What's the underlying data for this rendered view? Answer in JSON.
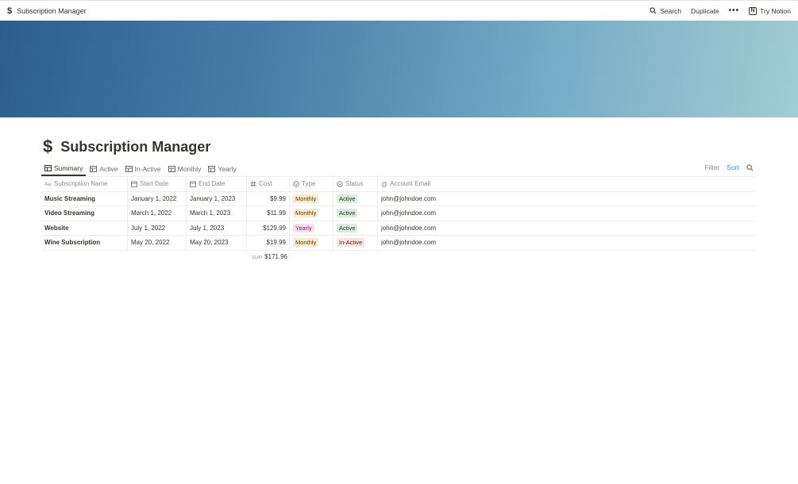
{
  "topbar": {
    "breadcrumb_icon": "$",
    "breadcrumb_title": "Subscription Manager",
    "search_label": "Search",
    "duplicate_label": "Duplicate",
    "more_label": "•••",
    "try_notion_label": "Try Notion"
  },
  "page": {
    "icon": "$",
    "title": "Subscription Manager"
  },
  "tabs": [
    {
      "label": "Summary",
      "active": true
    },
    {
      "label": "Active"
    },
    {
      "label": "In-Active"
    },
    {
      "label": "Monthly"
    },
    {
      "label": "Yearly"
    }
  ],
  "tools": {
    "filter_label": "Filter",
    "sort_label": "Sort"
  },
  "table": {
    "columns": [
      "Subscription Name",
      "Start Date",
      "End Date",
      "Cost",
      "Type",
      "Status",
      "Account Email"
    ],
    "rows": [
      {
        "name": "Music Streaming",
        "start": "January 1, 2022",
        "end": "January 1, 2023",
        "cost": "$9.99",
        "type": "Monthly",
        "status": "Active",
        "email": "john@johndoe.com"
      },
      {
        "name": "Video Streaming",
        "start": "March 1, 2022",
        "end": "March 1, 2023",
        "cost": "$11.99",
        "type": "Monthly",
        "status": "Active",
        "email": "john@johndoe.com"
      },
      {
        "name": "Website",
        "start": "July 1, 2022",
        "end": "July 1, 2023",
        "cost": "$129.99",
        "type": "Yearly",
        "status": "Active",
        "email": "john@johndoe.com"
      },
      {
        "name": "Wine Subscription",
        "start": "May 20, 2022",
        "end": "May 20, 2023",
        "cost": "$19.99",
        "type": "Monthly",
        "status": "In-Active",
        "email": "john@johndoe.com"
      }
    ],
    "sum_label": "SUM",
    "sum_value": "$171.96"
  }
}
